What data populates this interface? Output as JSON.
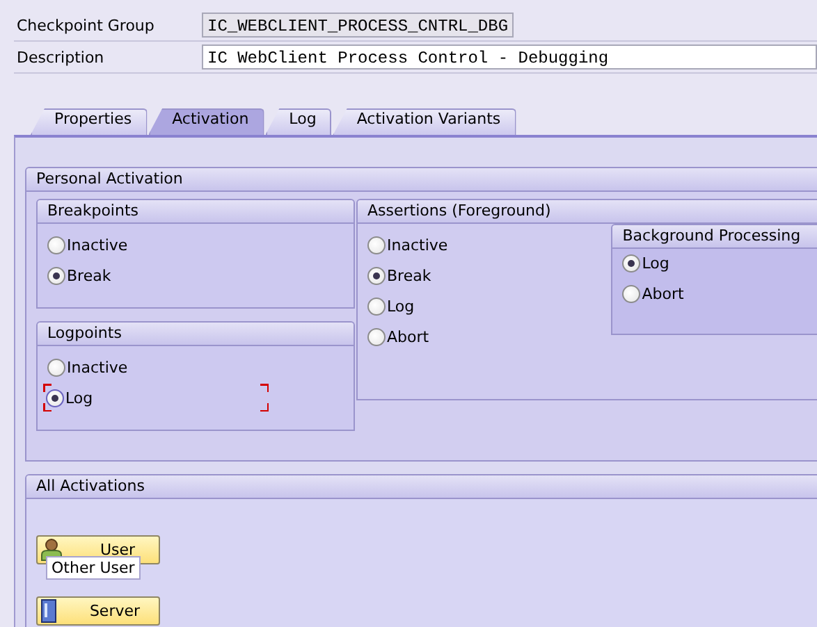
{
  "header_fields": [
    {
      "label": "Checkpoint Group",
      "value": "IC_WEBCLIENT_PROCESS_CNTRL_DBG",
      "editable": false
    },
    {
      "label": "Description",
      "value": "IC WebClient Process Control - Debugging",
      "editable": true
    }
  ],
  "tabs": [
    {
      "label": "Properties",
      "selected": false
    },
    {
      "label": "Activation",
      "selected": true
    },
    {
      "label": "Log",
      "selected": false
    },
    {
      "label": "Activation Variants",
      "selected": false
    }
  ],
  "personal_activation": {
    "title": "Personal Activation",
    "breakpoints": {
      "title": "Breakpoints",
      "options": [
        {
          "label": "Inactive",
          "selected": false
        },
        {
          "label": "Break",
          "selected": true
        }
      ]
    },
    "logpoints": {
      "title": "Logpoints",
      "options": [
        {
          "label": "Inactive",
          "selected": false,
          "focused": false
        },
        {
          "label": "Log",
          "selected": true,
          "focused": true
        }
      ]
    },
    "assertions": {
      "title": "Assertions (Foreground)",
      "options": [
        {
          "label": "Inactive",
          "selected": false
        },
        {
          "label": "Break",
          "selected": true
        },
        {
          "label": "Log",
          "selected": false
        },
        {
          "label": "Abort",
          "selected": false
        }
      ],
      "background_processing": {
        "title": "Background Processing",
        "options": [
          {
            "label": "Log",
            "selected": true
          },
          {
            "label": "Abort",
            "selected": false
          }
        ]
      }
    }
  },
  "all_activations": {
    "title": "All Activations",
    "buttons": [
      {
        "label": "User",
        "kind": "user"
      },
      {
        "label": "Server",
        "kind": "server"
      }
    ],
    "tooltip": "Other User"
  }
}
